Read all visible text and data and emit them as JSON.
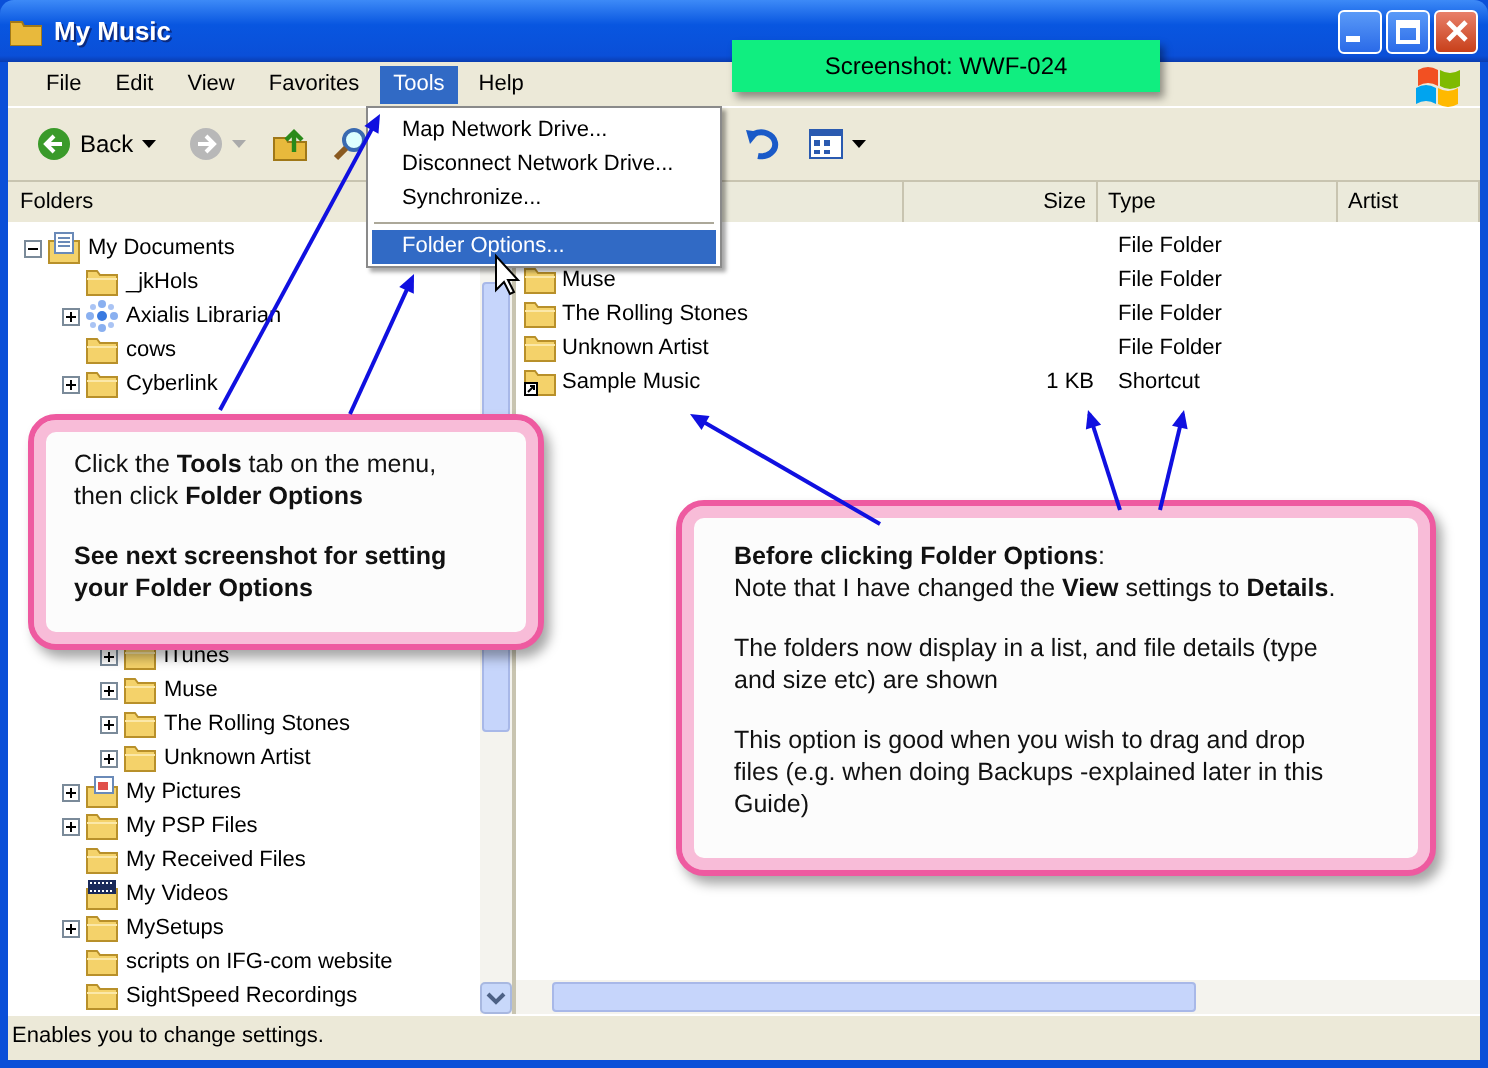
{
  "window": {
    "title": "My Music"
  },
  "screenshot_label": "Screenshot: WWF-024",
  "menu": [
    {
      "label": "File",
      "selected": false
    },
    {
      "label": "Edit",
      "selected": false
    },
    {
      "label": "View",
      "selected": false
    },
    {
      "label": "Favorites",
      "selected": false
    },
    {
      "label": "Tools",
      "selected": true
    },
    {
      "label": "Help",
      "selected": false
    }
  ],
  "toolbar": [
    {
      "kind": "back",
      "label": "Back",
      "disabled": false
    },
    {
      "kind": "forward",
      "disabled": true
    },
    {
      "kind": "up",
      "disabled": false
    },
    {
      "kind": "search",
      "disabled": false
    },
    {
      "kind": "undo",
      "disabled": false
    },
    {
      "kind": "views",
      "disabled": false
    }
  ],
  "dropdown": [
    {
      "kind": "item",
      "label": "Map Network Drive...",
      "selected": false
    },
    {
      "kind": "item",
      "label": "Disconnect Network Drive...",
      "selected": false
    },
    {
      "kind": "item",
      "label": "Synchronize...",
      "selected": false
    },
    {
      "kind": "separator"
    },
    {
      "kind": "item",
      "label": "Folder Options...",
      "selected": true
    }
  ],
  "folders_pane": {
    "title": "Folders"
  },
  "tree": [
    {
      "label": "My Documents",
      "kind": "documents",
      "expandable": true,
      "expanded": true,
      "children": [
        {
          "label": "_jkHols",
          "kind": "folder",
          "expandable": false
        },
        {
          "label": "Axialis Librarian",
          "kind": "app",
          "expandable": true,
          "expanded": false
        },
        {
          "label": "cows",
          "kind": "folder",
          "expandable": false
        },
        {
          "label": "Cyberlink",
          "kind": "folder",
          "expandable": true,
          "expanded": false
        },
        {
          "children": [
            {
              "label": "iTunes",
              "kind": "folder",
              "expandable": true,
              "expanded": false
            },
            {
              "label": "Muse",
              "kind": "folder",
              "expandable": true,
              "expanded": false
            },
            {
              "label": "The Rolling Stones",
              "kind": "folder",
              "expandable": true,
              "expanded": false
            },
            {
              "label": "Unknown Artist",
              "kind": "folder",
              "expandable": true,
              "expanded": false
            }
          ]
        },
        {
          "label": "My Pictures",
          "kind": "pictures",
          "expandable": true,
          "expanded": false
        },
        {
          "label": "My PSP Files",
          "kind": "folder",
          "expandable": true,
          "expanded": false
        },
        {
          "label": "My Received Files",
          "kind": "folder",
          "expandable": false
        },
        {
          "label": "My Videos",
          "kind": "videos",
          "expandable": false
        },
        {
          "label": "MySetups",
          "kind": "folder",
          "expandable": true,
          "expanded": false
        },
        {
          "label": "scripts on IFG-com website",
          "kind": "folder",
          "expandable": false
        },
        {
          "label": "SightSpeed Recordings",
          "kind": "folder",
          "expandable": false
        }
      ]
    }
  ],
  "list": {
    "columns": [
      "Size",
      "Type",
      "Artist"
    ],
    "rows": [
      {
        "type": "File Folder"
      },
      {
        "name": "Muse",
        "type": "File Folder",
        "kind": "folder"
      },
      {
        "name": "The Rolling Stones",
        "type": "File Folder",
        "kind": "folder"
      },
      {
        "name": "Unknown Artist",
        "type": "File Folder",
        "kind": "folder"
      },
      {
        "name": "Sample Music",
        "size": "1 KB",
        "type": "Shortcut",
        "kind": "shortcut"
      }
    ]
  },
  "callouts": [
    {
      "paragraphs": [
        {
          "text": "Click the **Tools** tab on the menu, then click **Folder Options**",
          "kind": "normal"
        },
        {
          "text": "See next screenshot for setting your Folder Options",
          "kind": "bold"
        }
      ]
    },
    {
      "heading": "**Before clicking Folder Options**:",
      "paragraphs": [
        {
          "text": "Note that I have changed the **View** settings to **Details**.",
          "kind": "normal"
        },
        {
          "text": "The folders now display in a list, and file details (type and size etc) are shown",
          "kind": "normal"
        },
        {
          "text": "This option is good when you wish to drag and drop files (e.g. when doing Backups -explained later in this Guide)",
          "kind": "normal"
        }
      ]
    }
  ],
  "status_bar": "Enables you to change settings."
}
